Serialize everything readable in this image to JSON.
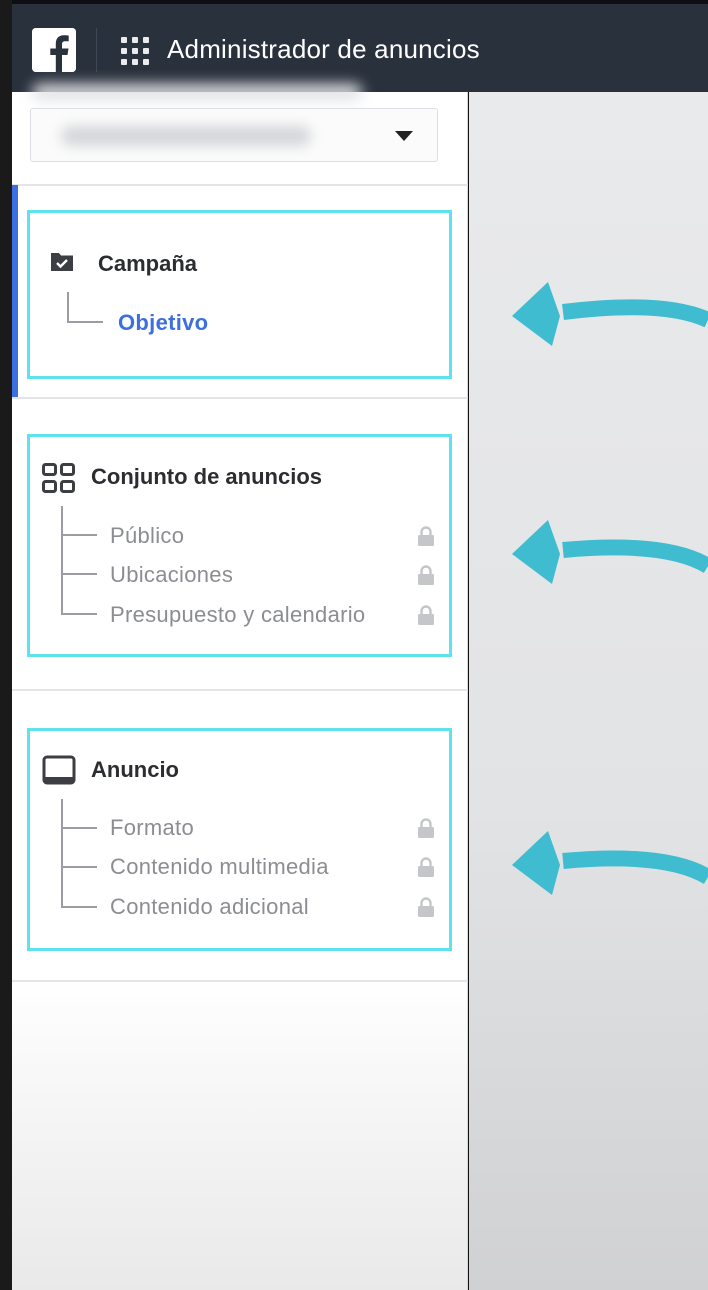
{
  "header": {
    "logo_icon": "facebook-logo-icon",
    "apps_icon": "apps-grid-icon",
    "title": "Administrador de anuncios"
  },
  "account_selector": {
    "value": "",
    "icon": "caret-down-icon"
  },
  "sections": [
    {
      "icon": "folder-check-icon",
      "title": "Campaña",
      "active": true,
      "items": [
        {
          "label": "Objetivo",
          "active": true,
          "locked": false
        }
      ]
    },
    {
      "icon": "grid-squares-icon",
      "title": "Conjunto de anuncios",
      "active": false,
      "items": [
        {
          "label": "Público",
          "active": false,
          "locked": true
        },
        {
          "label": "Ubicaciones",
          "active": false,
          "locked": true
        },
        {
          "label": "Presupuesto y calendario",
          "active": false,
          "locked": true
        }
      ]
    },
    {
      "icon": "monitor-icon",
      "title": "Anuncio",
      "active": false,
      "items": [
        {
          "label": "Formato",
          "active": false,
          "locked": true
        },
        {
          "label": "Contenido multimedia",
          "active": false,
          "locked": true
        },
        {
          "label": "Contenido adicional",
          "active": false,
          "locked": true
        }
      ]
    }
  ],
  "colors": {
    "topbar": "#29313d",
    "accent_blue": "#3d6fe0",
    "highlight_cyan": "#5ee3ee",
    "arrow_teal": "#3fbccf"
  }
}
